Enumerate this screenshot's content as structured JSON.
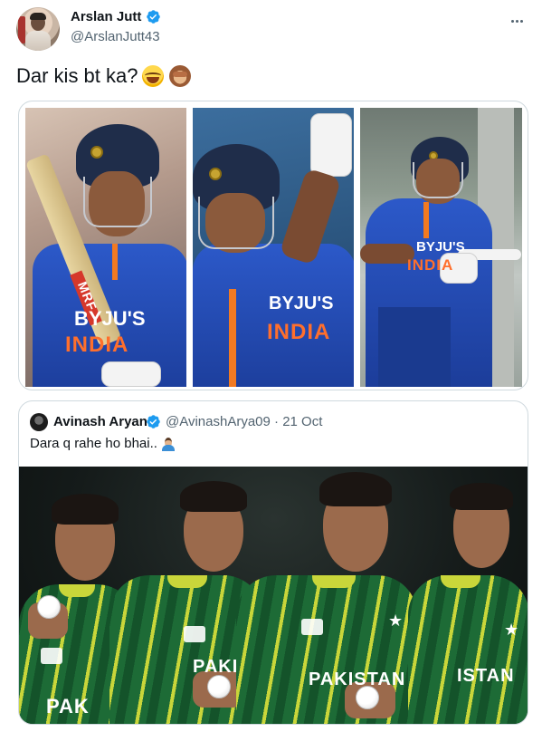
{
  "tweet": {
    "display_name": "Arslan Jutt",
    "handle": "@ArslanJutt43",
    "text": "Dar kis bt ka?",
    "emojis": [
      "face-with-tears-of-joy",
      "see-no-evil-monkey"
    ],
    "media": {
      "count": 3,
      "photos": [
        {
          "name": "india-player-1",
          "jersey_sponsor": "BYJU'S",
          "jersey_text": "INDIA",
          "bat_brand": "MRF"
        },
        {
          "name": "india-player-2",
          "jersey_sponsor": "BYJU'S",
          "jersey_text": "INDIA"
        },
        {
          "name": "india-player-3",
          "jersey_sponsor": "BYJU'S",
          "jersey_text": "INDIA"
        }
      ]
    }
  },
  "quoted_tweet": {
    "display_name": "Avinash Aryan",
    "handle": "@AvinashArya09",
    "separator": "·",
    "date": "21 Oct",
    "text": "Dara q rahe ho bhai..",
    "emoji": "man-shrugging",
    "media": {
      "name": "pakistan-players",
      "jersey_texts": [
        "PAK",
        "PAKIS",
        "PAKISTAN",
        "ISTAN"
      ]
    }
  },
  "colors": {
    "text_primary": "#0f1419",
    "text_secondary": "#536471",
    "verified_blue": "#1d9bf0",
    "border": "#cfd9de"
  },
  "icons": {
    "verified": "verified-badge-icon",
    "more": "more-horizontal-icon"
  }
}
